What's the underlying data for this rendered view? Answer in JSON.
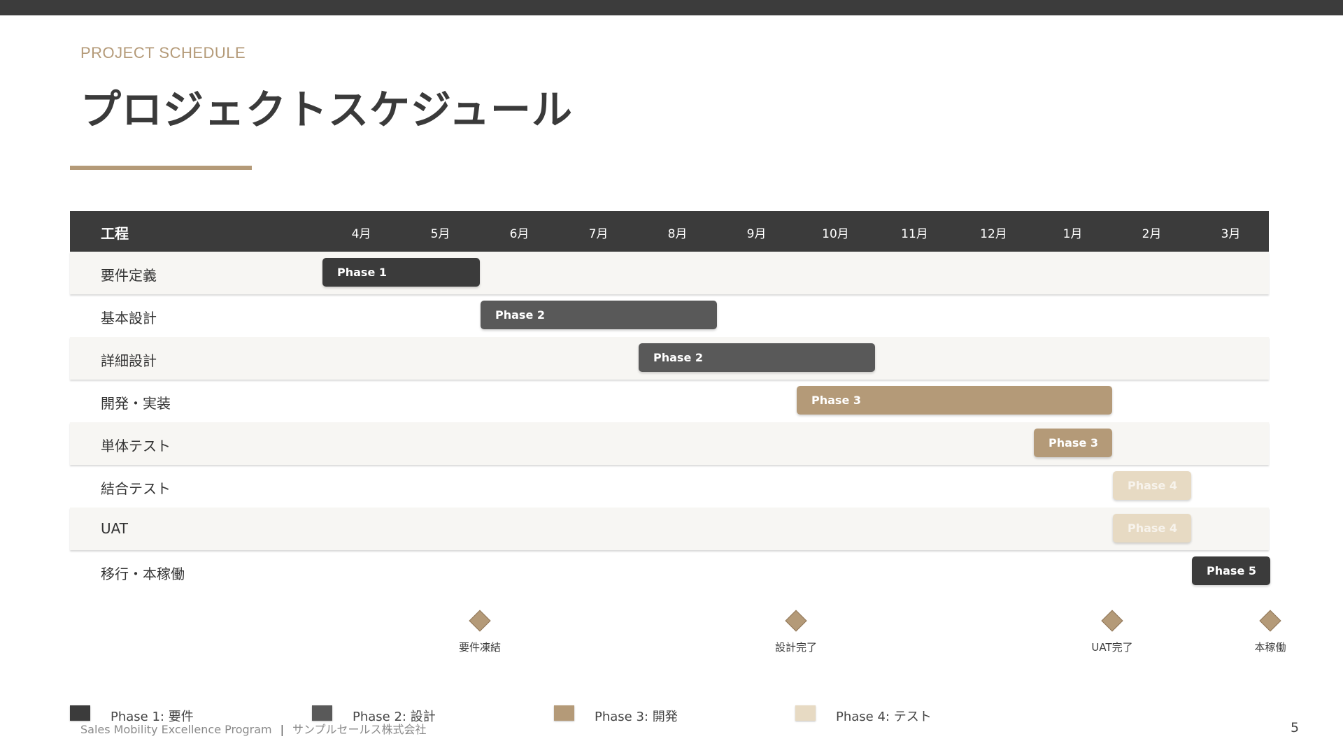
{
  "colors": {
    "phase1": "#3b3b3b",
    "phase2": "#595959",
    "phase3": "#b49a78",
    "phase4": "#e7dac3",
    "accent": "#b49a78",
    "header_bg": "#3b3b3b",
    "row_shade": "#f7f6f3"
  },
  "header": {
    "eyebrow": "PROJECT SCHEDULE",
    "title": "プロジェクトスケジュール"
  },
  "gantt": {
    "column_label": "工程",
    "months": [
      "4月",
      "5月",
      "6月",
      "7月",
      "8月",
      "9月",
      "10月",
      "11月",
      "12月",
      "1月",
      "2月",
      "3月"
    ],
    "tasks": [
      {
        "label": "要件定義",
        "start": 0,
        "end": 2,
        "phase": "Phase 1",
        "color_key": "phase1",
        "text_color": "#ffffff"
      },
      {
        "label": "基本設計",
        "start": 2,
        "end": 5,
        "phase": "Phase 2",
        "color_key": "phase2",
        "text_color": "#ffffff"
      },
      {
        "label": "詳細設計",
        "start": 4,
        "end": 7,
        "phase": "Phase 2",
        "color_key": "phase2",
        "text_color": "#ffffff"
      },
      {
        "label": "開発・実装",
        "start": 6,
        "end": 10,
        "phase": "Phase 3",
        "color_key": "phase3",
        "text_color": "#ffffff"
      },
      {
        "label": "単体テスト",
        "start": 9,
        "end": 10,
        "phase": "Phase 3",
        "color_key": "phase3",
        "text_color": "#ffffff"
      },
      {
        "label": "結合テスト",
        "start": 10,
        "end": 11,
        "phase": "Phase 4",
        "color_key": "phase4",
        "text_color": "#f7f3ec"
      },
      {
        "label": "UAT",
        "start": 10,
        "end": 11,
        "phase": "Phase 4",
        "color_key": "phase4",
        "text_color": "#f7f3ec"
      },
      {
        "label": "移行・本稼働",
        "start": 11,
        "end": 12,
        "phase": "Phase 5",
        "color_key": "phase1",
        "text_color": "#ffffff"
      }
    ]
  },
  "milestones": [
    {
      "label": "要件凍結",
      "at": 2
    },
    {
      "label": "設計完了",
      "at": 6
    },
    {
      "label": "UAT完了",
      "at": 10
    },
    {
      "label": "本稼働",
      "at": 12
    }
  ],
  "legend": [
    {
      "label": "Phase 1: 要件",
      "color_key": "phase1"
    },
    {
      "label": "Phase 2: 設計",
      "color_key": "phase2"
    },
    {
      "label": "Phase 3: 開発",
      "color_key": "phase3"
    },
    {
      "label": "Phase 4: テスト",
      "color_key": "phase4"
    }
  ],
  "footer": {
    "program": "Sales Mobility Excellence Program",
    "separator": "|",
    "company": "サンプルセールス株式会社",
    "page_number": "5"
  }
}
